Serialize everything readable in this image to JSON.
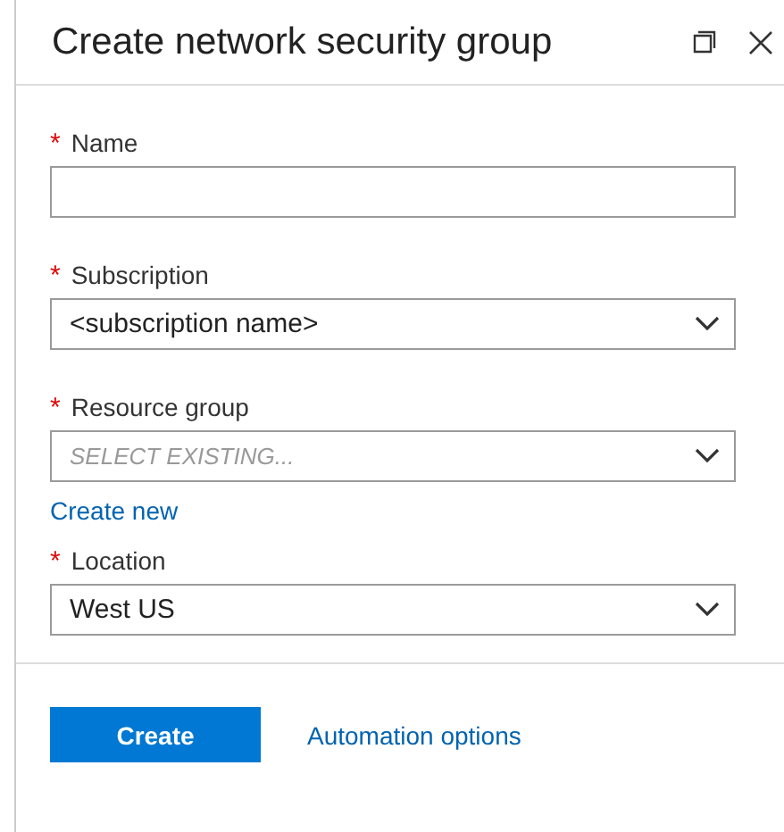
{
  "window": {
    "title": "Create network security group"
  },
  "fields": [
    {
      "kind": "text",
      "required_mark": "*",
      "label": "Name"
    },
    {
      "kind": "select",
      "required_mark": "*",
      "label": "Subscription",
      "value": "<subscription name>"
    },
    {
      "kind": "select",
      "required_mark": "*",
      "label": "Resource group",
      "placeholder": "SELECT EXISTING...",
      "link": "Create new"
    },
    {
      "kind": "select",
      "required_mark": "*",
      "label": "Location",
      "value": "West US"
    }
  ],
  "footer": {
    "primary_button": "Create",
    "link": "Automation options"
  }
}
